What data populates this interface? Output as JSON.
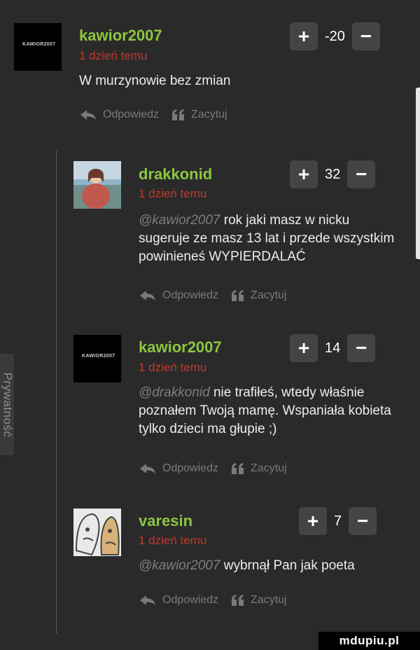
{
  "side_tab": "Prywatność",
  "vote_plus": "+",
  "vote_minus": "−",
  "watermark": "mdupiu.pl",
  "comments": [
    {
      "username": "kawior2007",
      "time": "1 dzień temu",
      "mention": "",
      "text": "W murzynowie bez zmian",
      "reply_label": "Odpowiedz",
      "quote_label": "Zacytuj",
      "votes": "-20",
      "avatar_text": "KAWIOR2007"
    },
    {
      "username": "drakkonid",
      "time": "1 dzień temu",
      "mention": "@kawior2007",
      "text": "rok jaki masz w nicku sugeruje ze masz 13 lat i przede wszystkim powinieneś WYPIERDALAĆ",
      "reply_label": "Odpowiedz",
      "quote_label": "Zacytuj",
      "votes": "32"
    },
    {
      "username": "kawior2007",
      "time": "1 dzień temu",
      "mention": "@drakkonid",
      "text": "nie trafiłeś, wtedy właśnie poznałem Twoją mamę. Wspaniała kobieta tylko dzieci ma głupie ;)",
      "reply_label": "Odpowiedz",
      "quote_label": "Zacytuj",
      "votes": "14",
      "avatar_text": "KAWIOR2007"
    },
    {
      "username": "varesin",
      "time": "1 dzień temu",
      "mention": "@kawior2007",
      "text": "wybrnął Pan jak poeta",
      "reply_label": "Odpowiedz",
      "quote_label": "Zacytuj",
      "votes": "7"
    }
  ]
}
